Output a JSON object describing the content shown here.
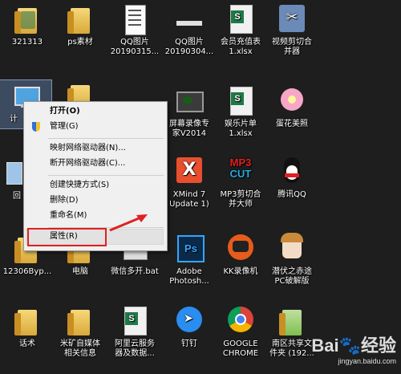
{
  "desktop": {
    "icons": {
      "i321313": "321313",
      "ps": "ps素材",
      "qq1": "QQ图片\n20190315...",
      "qq2": "QQ图片\n20190304...",
      "hyxls": "会员充值表\n1.xlsx",
      "video": "视频剪切合\n并器",
      "computer": "计",
      "ppt": "",
      "record": "屏幕录像专\n家V2014",
      "ent": "娱乐片单\n1.xlsx",
      "egg": "蛋花美照",
      "recycle": "回",
      "xmind": "XMind 7\nUpdate 1)",
      "mp3": "MP3剪切合\n并大师",
      "qq": "腾讯QQ",
      "f12306": "12306Byp...",
      "comp2": "电脑",
      "weixin": "微信多开.bat",
      "ps_app": "Adobe\nPhotosh...",
      "kk": "KK录像机",
      "game": "潜伏之赤途\nPC破解版",
      "huashu": "话术",
      "mikuang": "米矿自媒体\n相关信息",
      "aliyun": "阿里云服务\n器及数据...",
      "dingding": "钉钉",
      "chrome": "GOOGLE\nCHROME",
      "nanqu": "南区共享文\n件夹 (192..."
    }
  },
  "context_menu": {
    "items": [
      {
        "label": "打开(O)"
      },
      {
        "label": "管理(G)"
      },
      {
        "label": "映射网络驱动器(N)..."
      },
      {
        "label": "断开网络驱动器(C)..."
      },
      {
        "label": "创建快捷方式(S)"
      },
      {
        "label": "删除(D)"
      },
      {
        "label": "重命名(M)"
      },
      {
        "label": "属性(R)"
      }
    ]
  },
  "watermark": "jingyan.baidu.com",
  "colors": {
    "annotation": "#e02020",
    "desktop_bg": "#1e1e1e",
    "menu_bg": "#f0f0f0"
  }
}
